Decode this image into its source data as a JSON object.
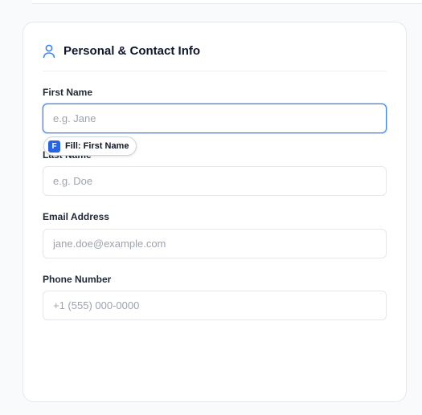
{
  "section": {
    "title": "Personal & Contact Info",
    "icon": "user-icon"
  },
  "fields": {
    "first_name": {
      "label": "First Name",
      "placeholder": "e.g. Jane",
      "value": ""
    },
    "last_name": {
      "label": "Last Name",
      "placeholder": "e.g. Doe",
      "value": ""
    },
    "email": {
      "label": "Email Address",
      "placeholder": "jane.doe@example.com",
      "value": ""
    },
    "phone": {
      "label": "Phone Number",
      "placeholder": "+1 (555) 000-0000",
      "value": ""
    }
  },
  "fill_badge": {
    "icon_letter": "F",
    "label": "Fill: First Name"
  },
  "colors": {
    "accent": "#3b82f6",
    "badge_icon": "#2563eb",
    "title_text": "#0f172a",
    "placeholder_text": "#9ca3af"
  }
}
